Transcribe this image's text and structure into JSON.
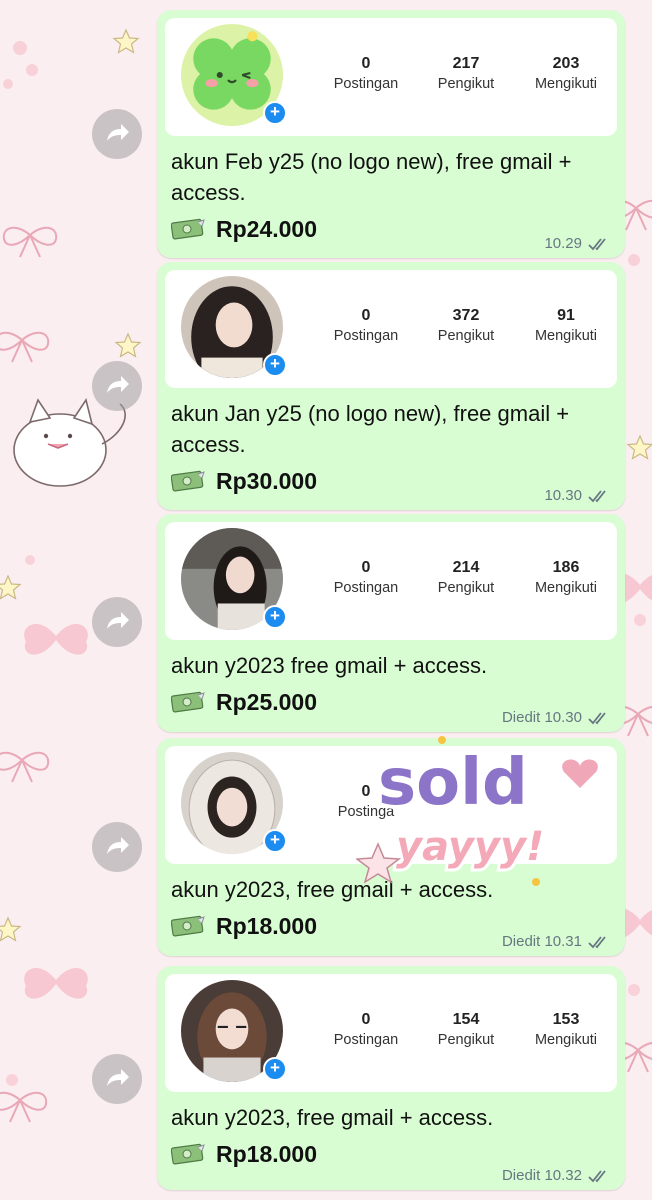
{
  "colors": {
    "bubble": "#d9fdd3",
    "card": "#ffffff",
    "follow_badge": "#1d8cf0",
    "meta_text": "#667781",
    "sticker_purple": "#8c74c8",
    "sticker_pink": "#f4a9b8"
  },
  "listings": [
    {
      "avatar": "clover-mascot-avatar",
      "stats": {
        "posts": "0",
        "followers": "217",
        "following": "203"
      },
      "labels": {
        "posts": "Postingan",
        "followers": "Pengikut",
        "following": "Mengikuti"
      },
      "description": "akun Feb y25 (no logo new), free gmail + access.",
      "price": "Rp24.000",
      "time": "10.29"
    },
    {
      "avatar": "girl-avatar",
      "stats": {
        "posts": "0",
        "followers": "372",
        "following": "91"
      },
      "labels": {
        "posts": "Postingan",
        "followers": "Pengikut",
        "following": "Mengikuti"
      },
      "description": "akun Jan y25 (no logo new), free gmail + access.",
      "price": "Rp30.000",
      "time": "10.30"
    },
    {
      "avatar": "girl-avatar",
      "stats": {
        "posts": "0",
        "followers": "214",
        "following": "186"
      },
      "labels": {
        "posts": "Postingan",
        "followers": "Pengikut",
        "following": "Mengikuti"
      },
      "description": "akun y2023 free gmail + access.",
      "price": "Rp25.000",
      "time": "Diedit 10.30"
    },
    {
      "avatar": "hooded-girl-avatar",
      "stats": {
        "posts": "0",
        "followers": "",
        "following": ""
      },
      "labels": {
        "posts": "Postinga",
        "followers": "",
        "following": ""
      },
      "description": "akun y2023, free gmail + access.",
      "price": "Rp18.000",
      "time": "Diedit 10.31"
    },
    {
      "avatar": "girl-avatar",
      "stats": {
        "posts": "0",
        "followers": "154",
        "following": "153"
      },
      "labels": {
        "posts": "Postingan",
        "followers": "Pengikut",
        "following": "Mengikuti"
      },
      "description": "akun y2023, free gmail + access.",
      "price": "Rp18.000",
      "time": "Diedit 10.32"
    }
  ],
  "sticker": {
    "line1": "sold",
    "line2": "yayyy!"
  }
}
